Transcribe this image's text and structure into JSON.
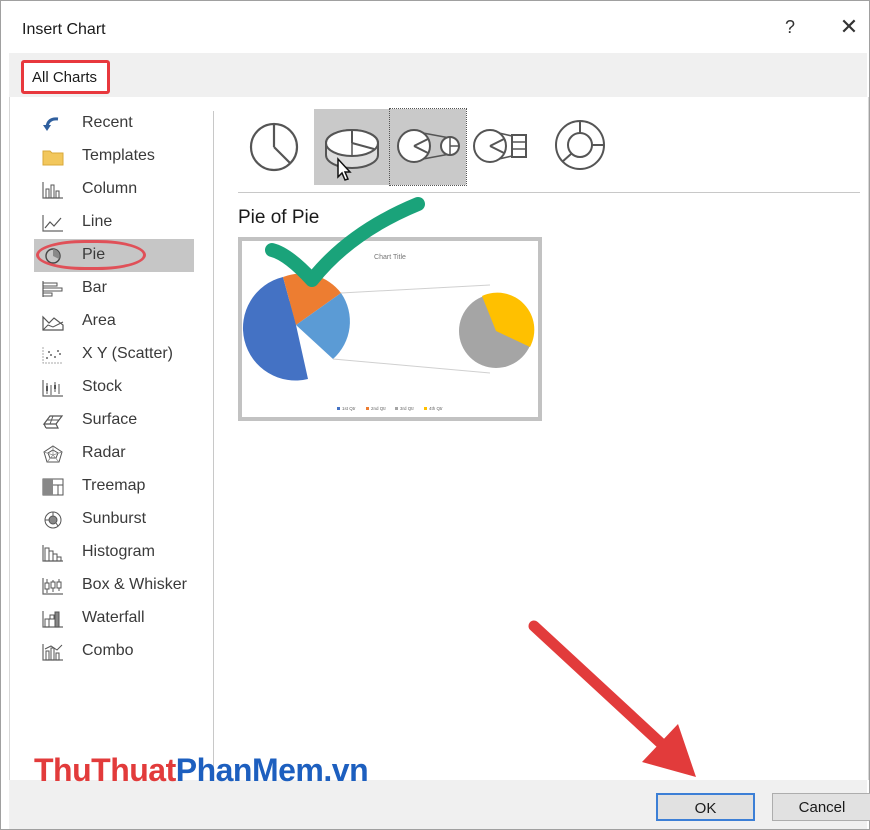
{
  "dialog": {
    "title": "Insert Chart",
    "help_label": "?",
    "close_label": "✕"
  },
  "tabs": [
    {
      "label": "All Charts"
    }
  ],
  "chart_types": [
    {
      "label": "Recent",
      "icon": "recent-icon"
    },
    {
      "label": "Templates",
      "icon": "folder-icon"
    },
    {
      "label": "Column",
      "icon": "column-chart-icon"
    },
    {
      "label": "Line",
      "icon": "line-chart-icon"
    },
    {
      "label": "Pie",
      "icon": "pie-chart-icon",
      "selected": true
    },
    {
      "label": "Bar",
      "icon": "bar-chart-icon"
    },
    {
      "label": "Area",
      "icon": "area-chart-icon"
    },
    {
      "label": "X Y (Scatter)",
      "icon": "scatter-chart-icon"
    },
    {
      "label": "Stock",
      "icon": "stock-chart-icon"
    },
    {
      "label": "Surface",
      "icon": "surface-chart-icon"
    },
    {
      "label": "Radar",
      "icon": "radar-chart-icon"
    },
    {
      "label": "Treemap",
      "icon": "treemap-chart-icon"
    },
    {
      "label": "Sunburst",
      "icon": "sunburst-chart-icon"
    },
    {
      "label": "Histogram",
      "icon": "histogram-chart-icon"
    },
    {
      "label": "Box & Whisker",
      "icon": "box-whisker-chart-icon"
    },
    {
      "label": "Waterfall",
      "icon": "waterfall-chart-icon"
    },
    {
      "label": "Combo",
      "icon": "combo-chart-icon"
    }
  ],
  "subtypes": [
    {
      "icon": "pie-subtype-icon"
    },
    {
      "icon": "3d-pie-subtype-icon",
      "state": "hover"
    },
    {
      "icon": "pie-of-pie-subtype-icon",
      "state": "selected"
    },
    {
      "icon": "bar-of-pie-subtype-icon"
    },
    {
      "icon": "doughnut-subtype-icon"
    }
  ],
  "selected_subtype_name": "Pie of Pie",
  "preview": {
    "chart_title": "Chart Title",
    "legend": [
      "1st Qtr",
      "2nd Qtr",
      "3rd Qtr",
      "4th Qtr"
    ],
    "colors": [
      "#4472c4",
      "#ed7d31",
      "#a5a5a5",
      "#ffc000",
      "#5b9bd5"
    ]
  },
  "buttons": {
    "ok": "OK",
    "cancel": "Cancel"
  },
  "watermark": {
    "part1": "ThuThuat",
    "part2": "PhanMem",
    "part3": ".vn"
  },
  "colors": {
    "annotation_red": "#e23b3b",
    "check_green": "#1aa37a",
    "ok_border": "#3c7fd6"
  }
}
